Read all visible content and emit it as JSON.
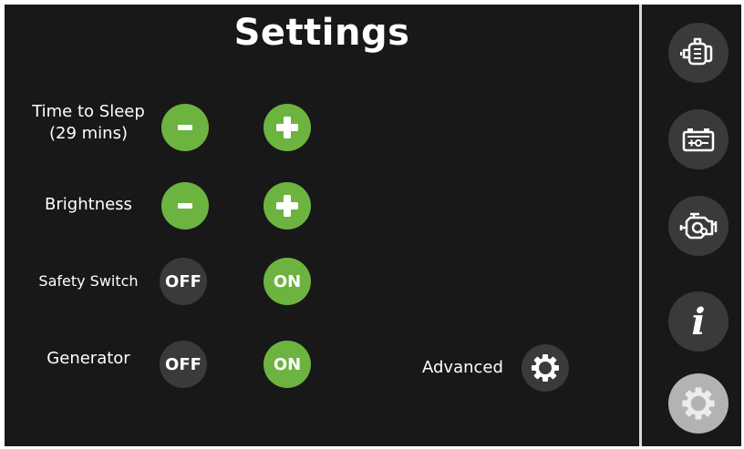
{
  "title": "Settings",
  "rows": {
    "sleep": {
      "label_line1": "Time to Sleep",
      "label_line2": "(29 mins)"
    },
    "brightness": {
      "label": "Brightness"
    },
    "safety": {
      "label": "Safety Switch",
      "off_label": "OFF",
      "on_label": "ON"
    },
    "generator": {
      "label": "Generator",
      "off_label": "OFF",
      "on_label": "ON"
    }
  },
  "advanced": {
    "label": "Advanced"
  },
  "sidebar": {
    "items": [
      {
        "icon": "alternator-icon"
      },
      {
        "icon": "battery-icon"
      },
      {
        "icon": "engine-icon"
      },
      {
        "icon": "info-icon",
        "glyph": "i"
      },
      {
        "icon": "gear-icon",
        "active": true
      }
    ]
  },
  "colors": {
    "background": "#181818",
    "accent_green": "#6cb43f",
    "button_dark": "#3a3a3a",
    "active_nav": "#b3b3b3"
  }
}
